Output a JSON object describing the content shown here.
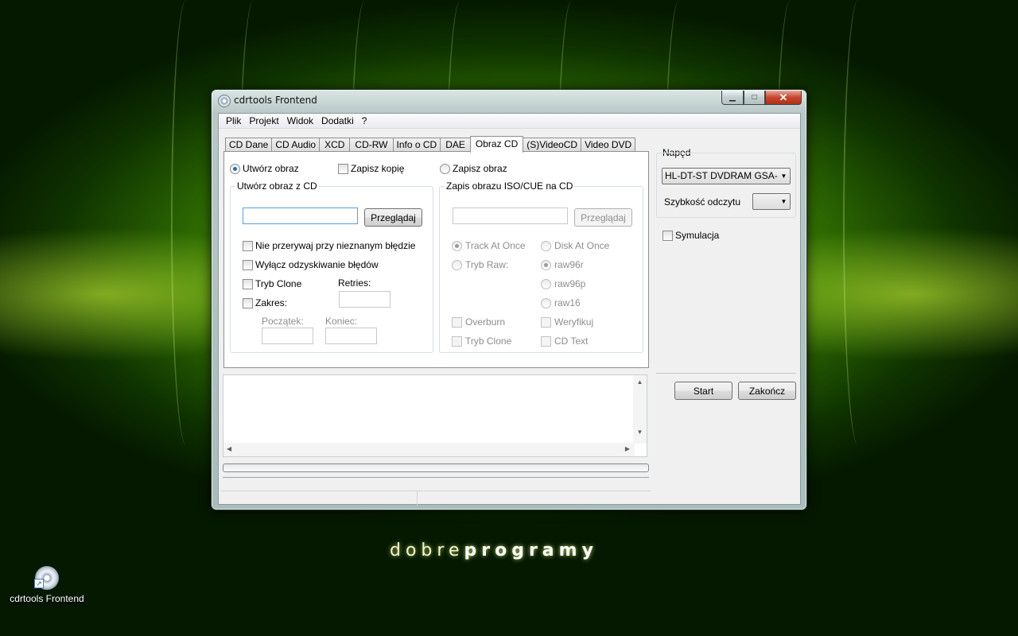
{
  "window": {
    "title": "cdrtools Frontend"
  },
  "menu": [
    "Plik",
    "Projekt",
    "Widok",
    "Dodatki",
    "?"
  ],
  "tabs": [
    "CD Dane",
    "CD Audio",
    "XCD",
    "CD-RW",
    "Info o CD",
    "DAE",
    "Obraz CD",
    "(S)VideoCD",
    "Video DVD"
  ],
  "active_tab": "Obraz CD",
  "mode": {
    "create_image": "Utwórz obraz",
    "save_copy": "Zapisz kopię",
    "write_image": "Zapisz obraz",
    "selected": "Utwórz obraz"
  },
  "create_group": {
    "title": "Utwórz obraz z CD",
    "path_value": "",
    "browse": "Przeglądaj",
    "opt_ignore_errors": "Nie przerywaj przy nieznanym błędzie",
    "opt_no_recovery": "Wyłącz odzyskiwanie błędów",
    "opt_clone": "Tryb Clone",
    "retries_label": "Retries:",
    "opt_range": "Zakres:",
    "start_label": "Początek:",
    "end_label": "Koniec:"
  },
  "write_group": {
    "title": "Zapis obrazu ISO/CUE na CD",
    "browse": "Przeglądaj",
    "track_at_once": "Track At Once",
    "disk_at_once": "Disk At Once",
    "raw_mode": "Tryb Raw:",
    "raw96r": "raw96r",
    "raw96p": "raw96p",
    "raw16": "raw16",
    "overburn": "Overburn",
    "verify": "Weryfikuj",
    "clone_mode": "Tryb Clone",
    "cd_text": "CD Text"
  },
  "drive": {
    "group_title": "Napęd",
    "selected_drive": "HL-DT-ST DVDRAM GSA-H",
    "read_speed_label": "Szybkość odczytu",
    "read_speed_value": "",
    "simulation": "Symulacja"
  },
  "actions": {
    "start": "Start",
    "close": "Zakończ"
  },
  "progress": 0,
  "desktop": {
    "brand_light": "dobre",
    "brand_bold": "programy",
    "shortcut_label": "cdrtools Frontend"
  }
}
